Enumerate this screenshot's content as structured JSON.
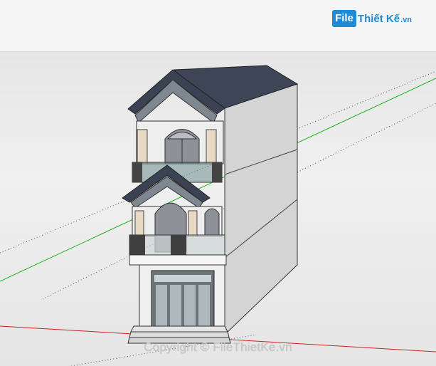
{
  "header": {
    "logo_box": "File",
    "logo_text": "Thiết Kế",
    "logo_domain": ".vn"
  },
  "watermark": {
    "text": "Copyright © FileThietKe.vn"
  },
  "colors": {
    "header_bg": "#f5f5f5",
    "brand_blue": "#1f8bd6",
    "viewport_bg": "#e8e8e8",
    "axis_green": "#1ab21a",
    "axis_red": "#cc2020",
    "roof": "#3f4758",
    "wall_side": "#d4d4d4",
    "wall_front": "#ececec"
  },
  "icons": [
    "file-logo-icon"
  ]
}
